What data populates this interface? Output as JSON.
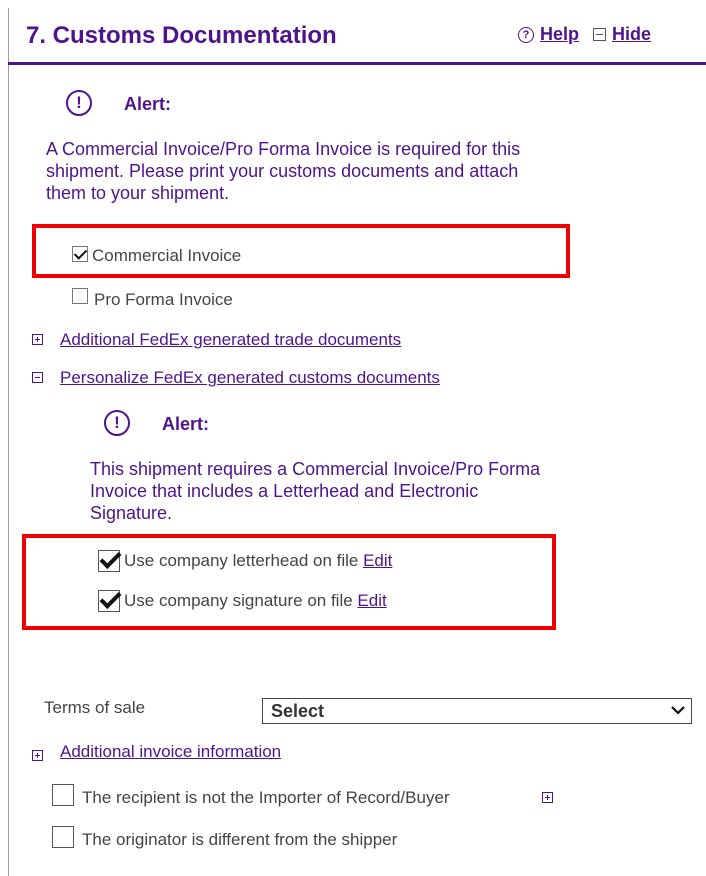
{
  "header": {
    "title": "7. Customs Documentation",
    "help_label": "Help",
    "hide_label": "Hide"
  },
  "alert1": {
    "title": "Alert:",
    "lines": [
      "A Commercial Invoice/Pro Forma Invoice is required for this",
      "shipment. Please print your customs documents and attach",
      "them to your shipment."
    ]
  },
  "docs": {
    "commercial_invoice": {
      "label": "Commercial Invoice",
      "checked": true
    },
    "pro_forma_invoice": {
      "label": "Pro Forma Invoice",
      "checked": false
    }
  },
  "expanders": {
    "additional_trade": "Additional FedEx generated trade documents",
    "personalize": "Personalize FedEx generated customs documents",
    "additional_invoice": "Additional invoice information"
  },
  "alert2": {
    "title": "Alert:",
    "lines": [
      "This shipment requires a Commercial Invoice/Pro Forma",
      "Invoice that includes a Letterhead and Electronic",
      "Signature."
    ]
  },
  "personalize": {
    "letterhead": {
      "label": "Use company letterhead on file",
      "edit": "Edit",
      "checked": true
    },
    "signature": {
      "label": "Use company signature on file",
      "edit": "Edit",
      "checked": true
    }
  },
  "terms_of_sale": {
    "label": "Terms of sale",
    "value": "Select"
  },
  "options": {
    "not_importer": {
      "label": "The recipient is not the Importer of Record/Buyer",
      "checked": false
    },
    "originator_diff": {
      "label": "The originator is different from the shipper",
      "checked": false
    }
  },
  "colors": {
    "accent": "#4d148c",
    "highlight": "#ee0000"
  }
}
